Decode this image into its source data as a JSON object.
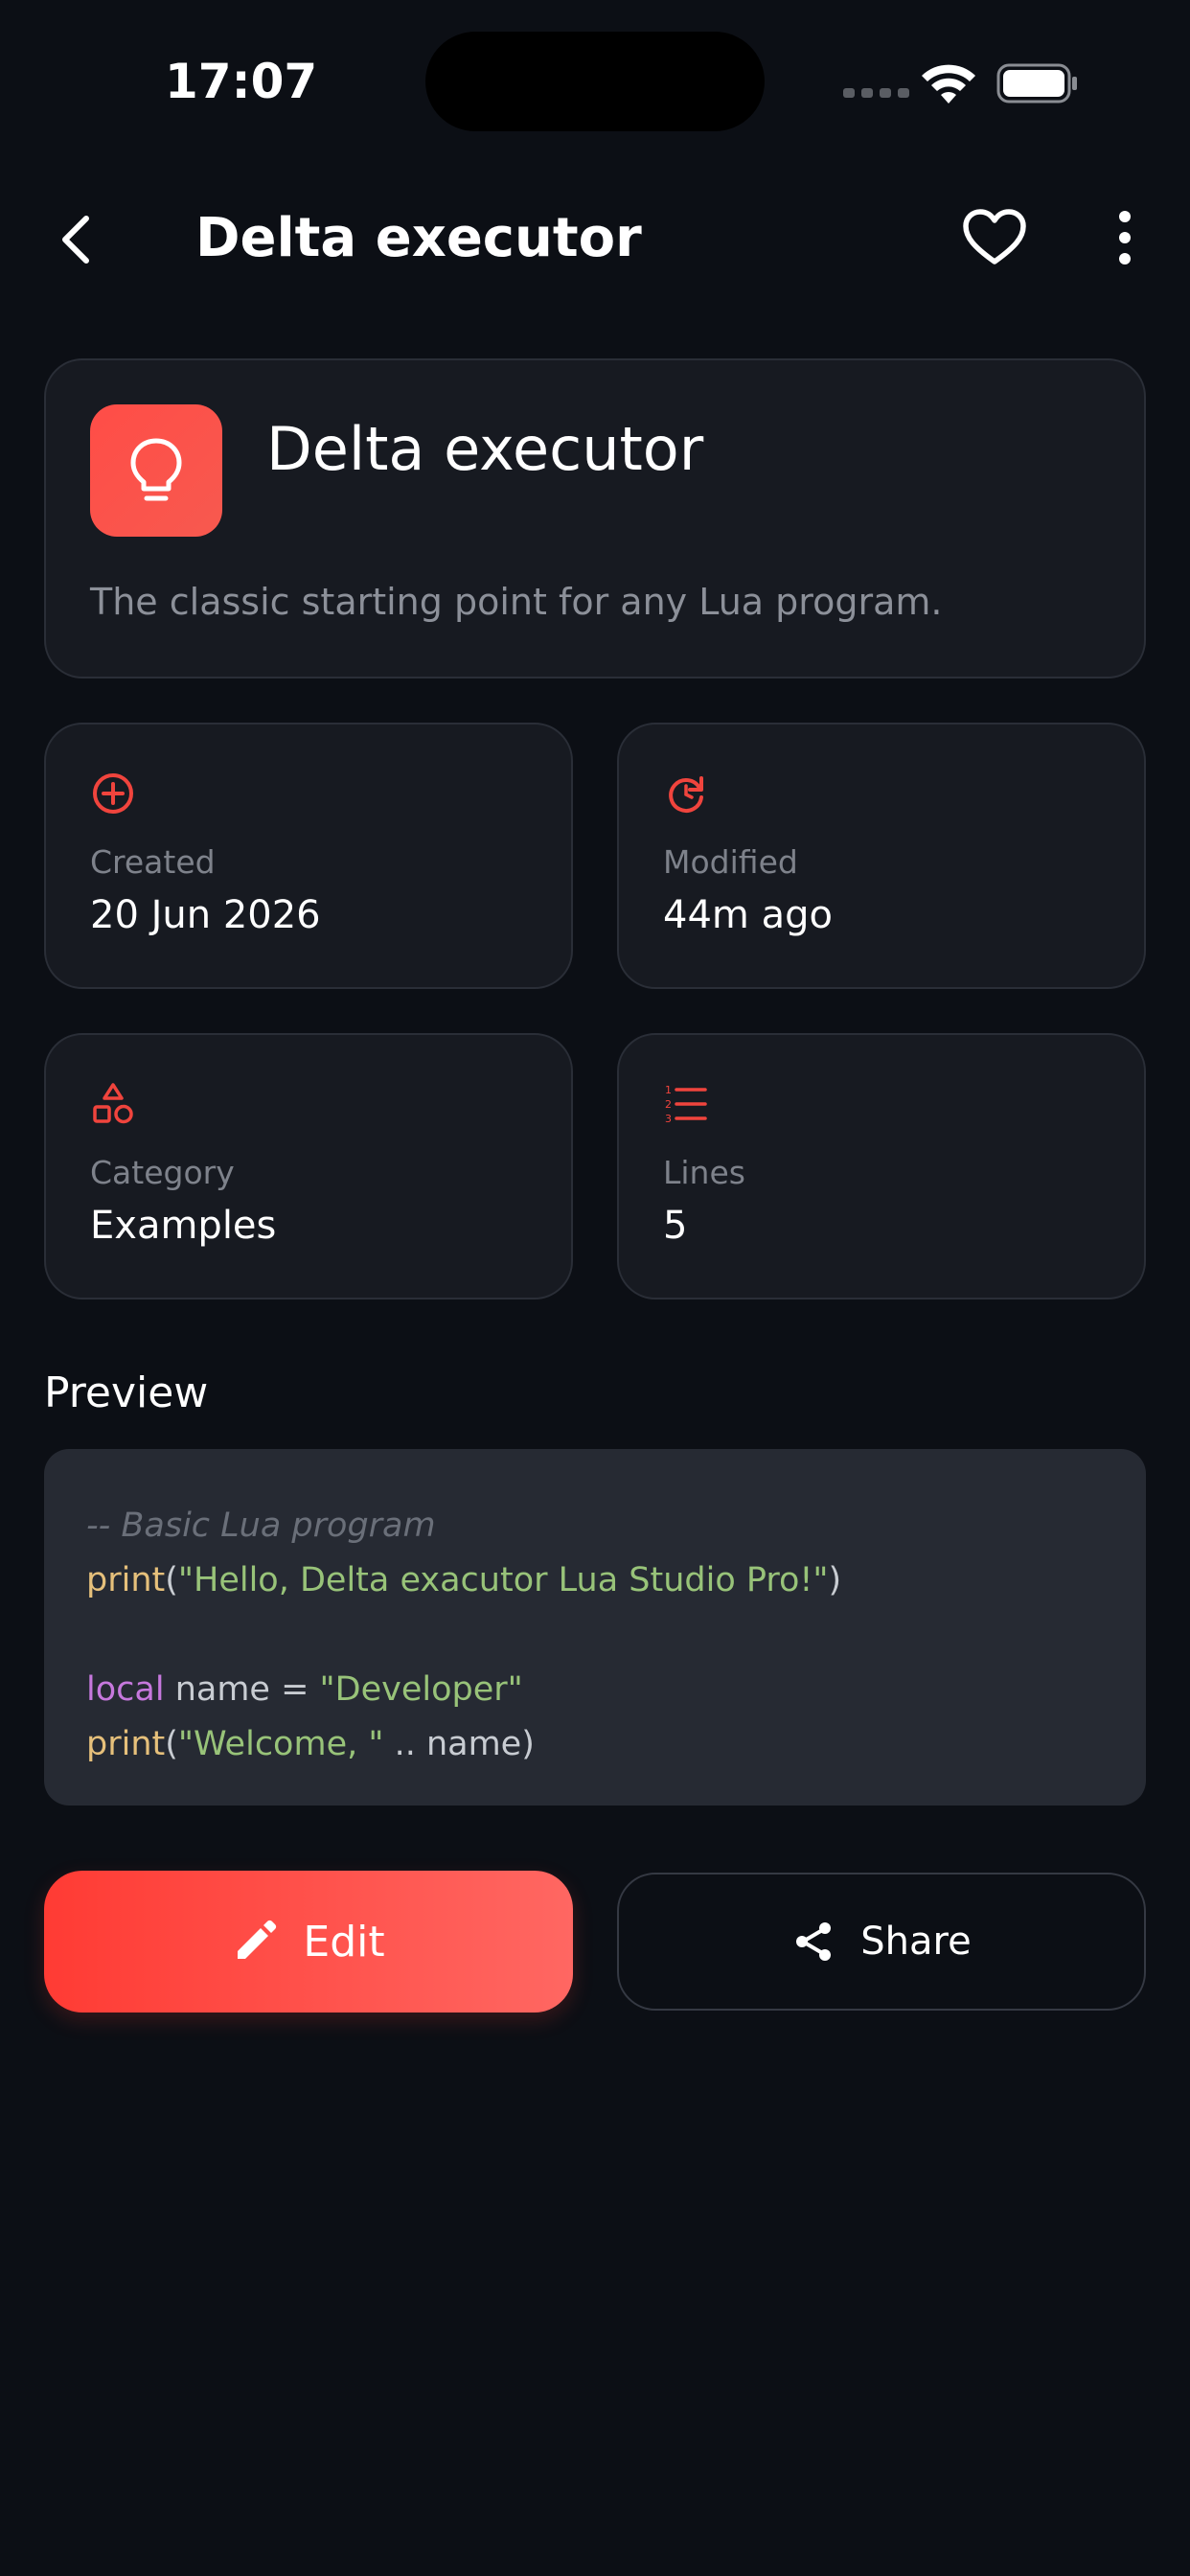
{
  "status_bar": {
    "time": "17:07"
  },
  "header": {
    "title": "Delta executor"
  },
  "info_card": {
    "title": "Delta executor",
    "description": "The classic starting point for any Lua program."
  },
  "stats": {
    "created": {
      "label": "Created",
      "value": "20 Jun 2026"
    },
    "modified": {
      "label": "Modified",
      "value": "44m ago"
    },
    "category": {
      "label": "Category",
      "value": "Examples"
    },
    "lines": {
      "label": "Lines",
      "value": "5"
    }
  },
  "preview": {
    "title": "Preview",
    "code": {
      "line1_comment": "-- Basic Lua program",
      "line2_fn": "print",
      "line2_open": "(",
      "line2_str": "\"Hello, Delta exacutor Lua Studio Pro!\"",
      "line2_close": ")",
      "line4_kw": "local",
      "line4_rest": " name = ",
      "line4_str": "\"Developer\"",
      "line5_fn": "print",
      "line5_open": "(",
      "line5_str": "\"Welcome, \"",
      "line5_rest": " .. name)"
    }
  },
  "actions": {
    "edit_label": "Edit",
    "share_label": "Share"
  },
  "colors": {
    "accent": "#ff4d47",
    "background": "#0c0f15",
    "card": "#171a21",
    "code_bg": "#262a33"
  },
  "icons": {
    "back": "chevron-left-icon",
    "favorite": "heart-outline-icon",
    "more": "more-vertical-icon",
    "app": "lightbulb-icon",
    "created": "plus-circle-icon",
    "modified": "refresh-icon",
    "category": "shapes-icon",
    "lines": "numbered-list-icon",
    "edit": "pencil-icon",
    "share": "share-icon"
  }
}
